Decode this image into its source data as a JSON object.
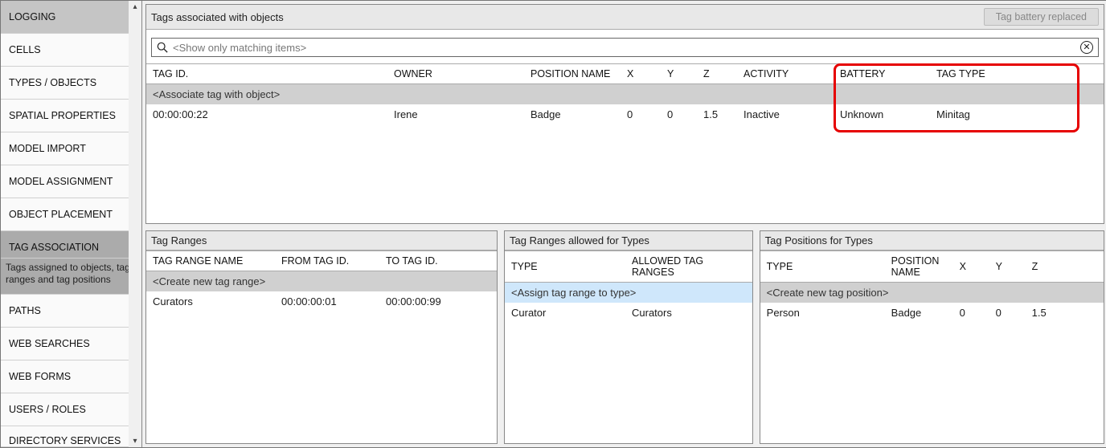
{
  "sidebar": {
    "items": [
      {
        "label": "LOGGING",
        "dark": true
      },
      {
        "label": "CELLS"
      },
      {
        "label": "TYPES / OBJECTS"
      },
      {
        "label": "SPATIAL PROPERTIES"
      },
      {
        "label": "MODEL IMPORT"
      },
      {
        "label": "MODEL ASSIGNMENT"
      },
      {
        "label": "OBJECT PLACEMENT"
      },
      {
        "label": "TAG ASSOCIATION",
        "active": true,
        "desc": "Tags assigned to objects, tag ranges and tag positions"
      },
      {
        "label": "PATHS"
      },
      {
        "label": "WEB SEARCHES"
      },
      {
        "label": "WEB FORMS"
      },
      {
        "label": "USERS / ROLES"
      },
      {
        "label": "DIRECTORY SERVICES"
      }
    ]
  },
  "topPanel": {
    "title": "Tags associated with objects",
    "button": "Tag battery replaced",
    "searchPlaceholder": "<Show only matching items>",
    "headers": [
      "TAG ID.",
      "OWNER",
      "POSITION NAME",
      "X",
      "Y",
      "Z",
      "ACTIVITY",
      "BATTERY",
      "TAG TYPE"
    ],
    "placeholder": "<Associate tag with object>",
    "row": {
      "tag_id": "00:00:00:22",
      "owner": "Irene",
      "position": "Badge",
      "x": "0",
      "y": "0",
      "z": "1.5",
      "activity": "Inactive",
      "battery": "Unknown",
      "tag_type": "Minitag"
    }
  },
  "tagRanges": {
    "title": "Tag Ranges",
    "headers": [
      "TAG RANGE NAME",
      "FROM TAG ID.",
      "TO TAG ID."
    ],
    "placeholder": "<Create new tag range>",
    "row": {
      "name": "Curators",
      "from": "00:00:00:01",
      "to": "00:00:00:99"
    }
  },
  "allowed": {
    "title": "Tag Ranges allowed for Types",
    "headers": [
      "TYPE",
      "ALLOWED TAG RANGES"
    ],
    "placeholder": "<Assign tag range to type>",
    "row": {
      "type": "Curator",
      "ranges": "Curators"
    }
  },
  "positions": {
    "title": "Tag Positions for Types",
    "headers": [
      "TYPE",
      "POSITION NAME",
      "X",
      "Y",
      "Z"
    ],
    "placeholder": "<Create new tag position>",
    "row": {
      "type": "Person",
      "position": "Badge",
      "x": "0",
      "y": "0",
      "z": "1.5"
    }
  }
}
